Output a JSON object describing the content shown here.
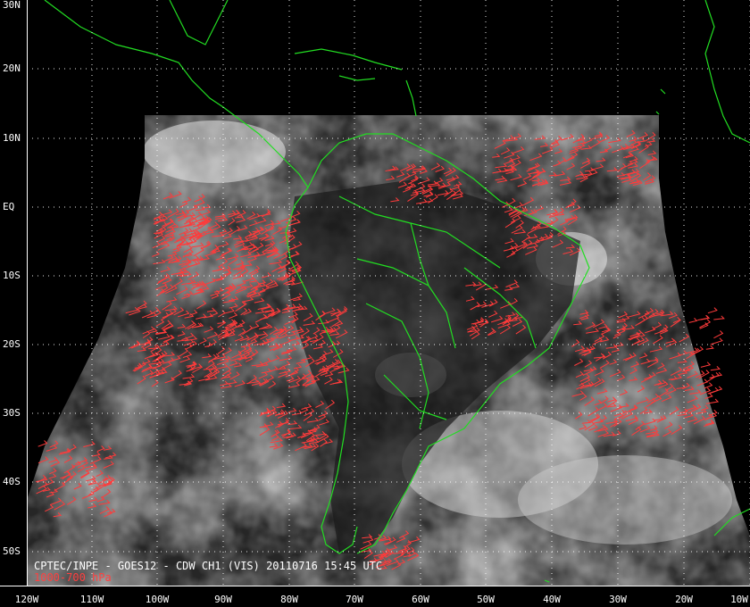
{
  "caption": {
    "line1": "CPTEC/INPE - GOES12 - CDW CH1 (VIS) 20110716 15:45 UTC",
    "line2": "1000-700 hPa"
  },
  "latitude_labels": [
    "30N",
    "20N",
    "10N",
    "EQ",
    "10S",
    "20S",
    "30S",
    "40S",
    "50S"
  ],
  "longitude_labels": [
    "120W",
    "110W",
    "100W",
    "90W",
    "80W",
    "70W",
    "60W",
    "50W",
    "40W",
    "30W",
    "20W",
    "10W"
  ],
  "colors": {
    "background": "#000000",
    "coastline": "#22dd22",
    "wind_vectors": "#ff3b3b",
    "grid": "#ffffff",
    "caption_text": "#ffffff",
    "level_text": "#ff4040"
  }
}
